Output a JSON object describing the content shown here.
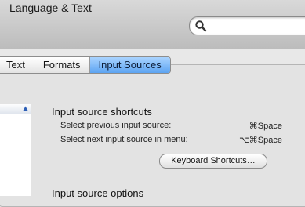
{
  "window": {
    "title": "Language & Text"
  },
  "search": {
    "placeholder": "",
    "icon": "search-icon"
  },
  "tabs": [
    {
      "label": "Text",
      "active": false
    },
    {
      "label": "Formats",
      "active": false
    },
    {
      "label": "Input Sources",
      "active": true
    }
  ],
  "shortcuts": {
    "heading": "Input source shortcuts",
    "rows": [
      {
        "label": "Select previous input source:",
        "key": "⌘Space"
      },
      {
        "label": "Select next input source in menu:",
        "key": "⌥⌘Space"
      }
    ],
    "button_label": "Keyboard Shortcuts…"
  },
  "options": {
    "heading": "Input source options"
  },
  "colors": {
    "accent": "#5da4f2",
    "chrome": "#c9c9c9"
  }
}
